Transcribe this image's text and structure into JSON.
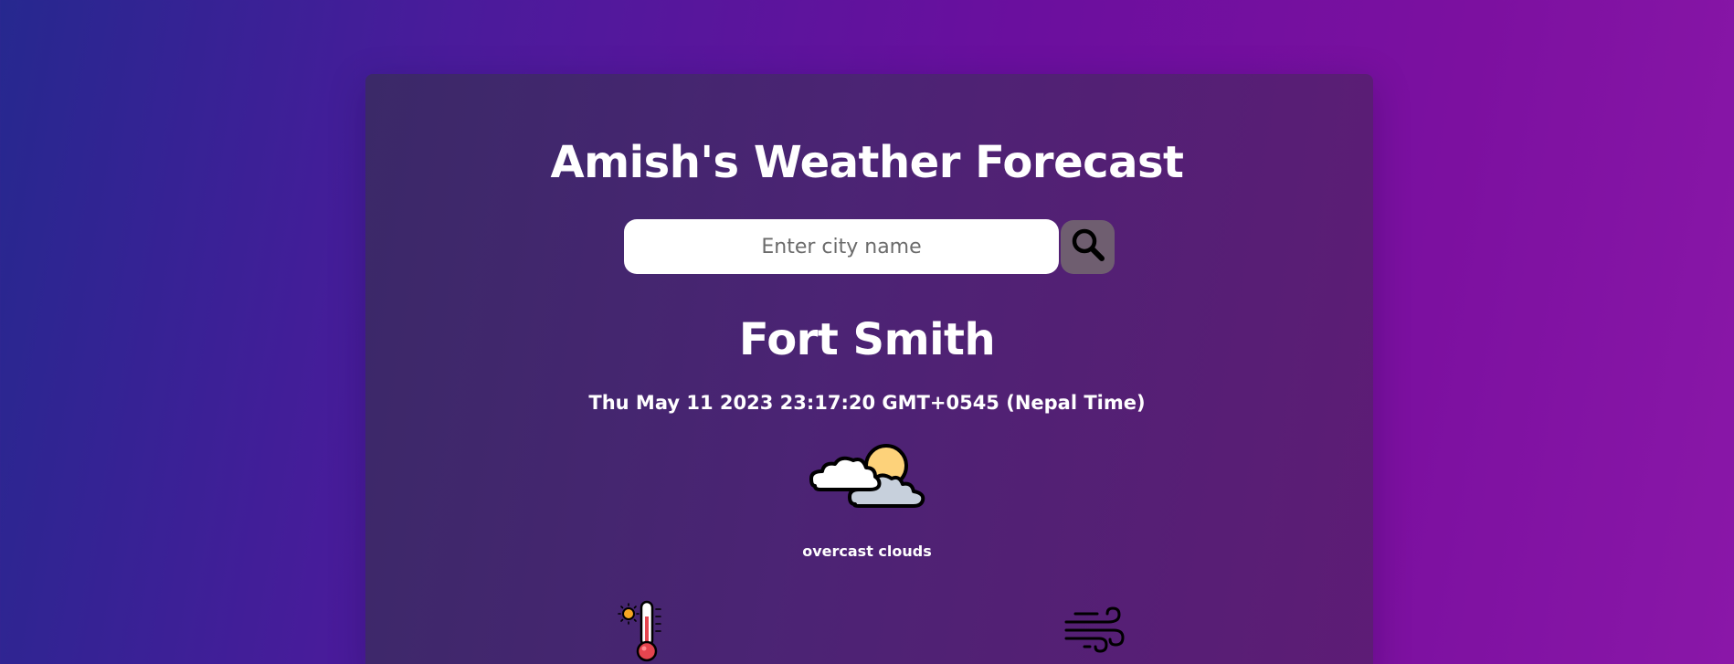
{
  "app": {
    "title": "Amish's Weather Forecast"
  },
  "search": {
    "placeholder": "Enter city name",
    "value": "",
    "button_icon": "search-icon"
  },
  "weather": {
    "city": "Fort Smith",
    "datetime": "Thu May 11 2023 23:17:20 GMT+0545 (Nepal Time)",
    "condition_icon": "cloudy-sun-icon",
    "description": "overcast clouds"
  },
  "details": {
    "temperature_icon": "thermometer-icon",
    "wind_icon": "wind-icon"
  },
  "colors": {
    "background_start": "#26288f",
    "background_end": "#8a17a8",
    "card": "#48266e",
    "search_button": "#6f5e70",
    "text": "#ffffff"
  }
}
